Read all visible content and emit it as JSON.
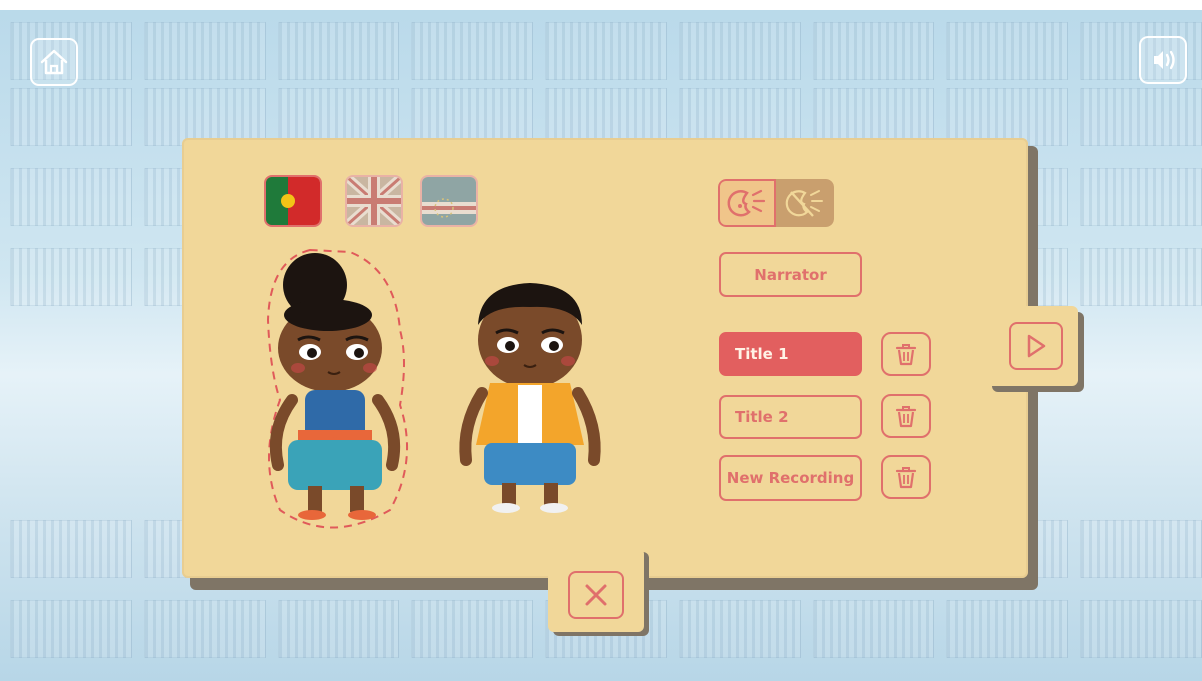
{
  "toolbar": {
    "home_icon": "home-icon",
    "sound_icon": "sound-icon"
  },
  "languages": [
    {
      "name": "portugal-flag",
      "selected": true
    },
    {
      "name": "uk-flag",
      "selected": false
    },
    {
      "name": "cape-verde-flag",
      "selected": false
    }
  ],
  "characters": [
    {
      "name": "girl-character",
      "selected": true
    },
    {
      "name": "boy-character",
      "selected": false
    }
  ],
  "mode": {
    "active": "speak-icon",
    "inactive": "mute-speak-icon"
  },
  "narrator_label": "Narrator",
  "recordings": [
    {
      "label": "Title 1",
      "active": true
    },
    {
      "label": "Title 2",
      "active": false
    },
    {
      "label": "New Recording",
      "active": false
    }
  ],
  "colors": {
    "accent": "#e25f5f",
    "board": "#f1d799",
    "outline": "#e0706c"
  }
}
